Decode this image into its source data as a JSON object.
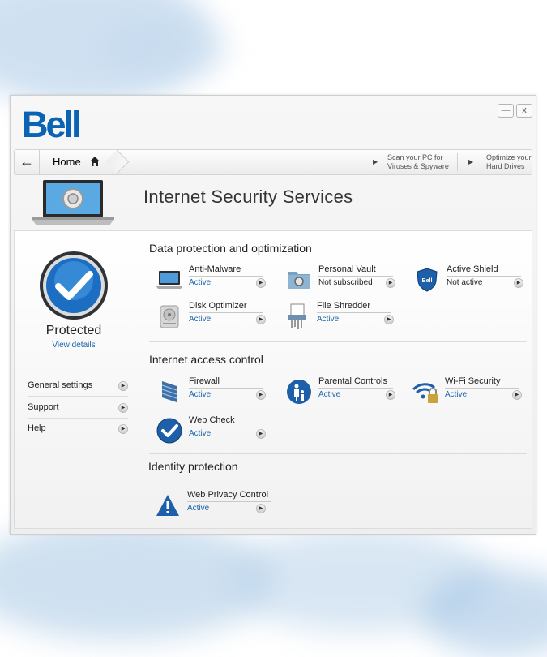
{
  "brand": {
    "logo_text": "Bell",
    "accent": "#0b63b3",
    "link": "#1a64ad"
  },
  "window": {
    "minimize_label": "—",
    "close_label": "x"
  },
  "nav": {
    "home_label": "Home",
    "quick_links": [
      {
        "line1": "Scan your PC for",
        "line2": "Viruses & Spyware"
      },
      {
        "line1": "Optimize your",
        "line2": "Hard Drives"
      }
    ]
  },
  "app_title": "Internet Security Services",
  "status": {
    "label": "Protected",
    "link": "View details"
  },
  "menu": [
    {
      "label": "General settings"
    },
    {
      "label": "Support"
    },
    {
      "label": "Help"
    }
  ],
  "sections": [
    {
      "title": "Data protection and optimization",
      "tiles": [
        {
          "name": "Anti-Malware",
          "status": "Active",
          "icon": "laptop-icon"
        },
        {
          "name": "Personal Vault",
          "status": "Not subscribed",
          "icon": "vault-icon"
        },
        {
          "name": "Active Shield",
          "status": "Not active",
          "icon": "shield-icon"
        },
        {
          "name": "Disk Optimizer",
          "status": "Active",
          "icon": "disk-icon"
        },
        {
          "name": "File Shredder",
          "status": "Active",
          "icon": "shredder-icon"
        }
      ]
    },
    {
      "title": "Internet access control",
      "tiles": [
        {
          "name": "Firewall",
          "status": "Active",
          "icon": "firewall-icon"
        },
        {
          "name": "Parental Controls",
          "status": "Active",
          "icon": "parental-icon"
        },
        {
          "name": "Wi-Fi Security",
          "status": "Active",
          "icon": "wifi-lock-icon"
        },
        {
          "name": "Web Check",
          "status": "Active",
          "icon": "checkmark-icon"
        }
      ]
    },
    {
      "title": "Identity protection",
      "tiles": [
        {
          "name": "Web Privacy Control",
          "status": "Active",
          "icon": "warning-icon"
        }
      ]
    }
  ]
}
